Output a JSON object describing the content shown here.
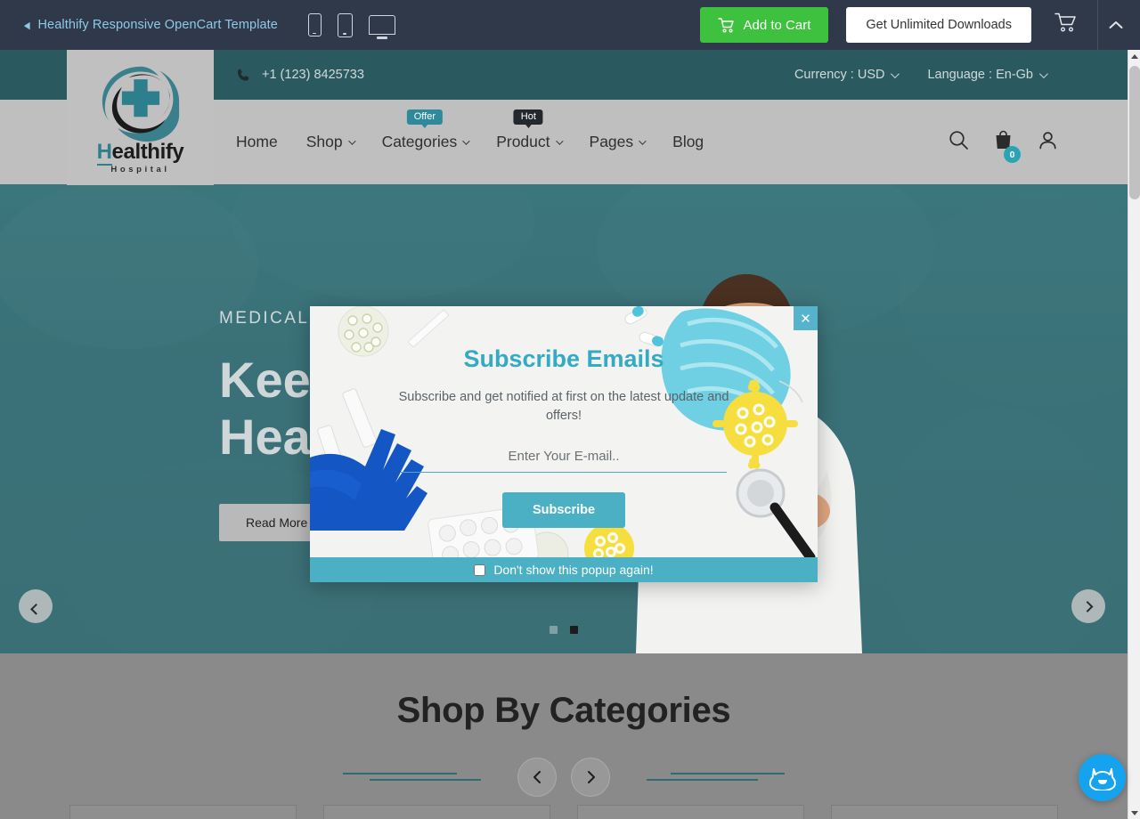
{
  "preview_bar": {
    "back_icon": "chevron-left-icon",
    "title": "Healthify Responsive OpenCart Template",
    "devices": [
      "phone-icon",
      "tablet-icon",
      "desktop-icon"
    ],
    "add_to_cart_label": "Add to Cart",
    "unlimited_label": "Get Unlimited Downloads",
    "cart_icon": "cart-icon",
    "collapse_icon": "chevron-up-icon",
    "bg_color": "#2f3949",
    "add_to_cart_color": "#3ec13e"
  },
  "topbar": {
    "phone_icon": "phone-icon",
    "phone": "+1 (123) 8425733",
    "currency_label": "Currency : USD",
    "language_label": "Language : En-Gb",
    "bg_color": "#2a5a60"
  },
  "logo": {
    "name": "Healthify",
    "name_first": "H",
    "name_rest": "ealthify",
    "tagline": "Hospital",
    "mark_icon": "medical-cross-swirl-logo"
  },
  "nav": {
    "items": [
      {
        "label": "Home",
        "has_dropdown": false,
        "badge": null
      },
      {
        "label": "Shop",
        "has_dropdown": true,
        "badge": null
      },
      {
        "label": "Categories",
        "has_dropdown": true,
        "badge": "Offer",
        "badge_type": "offer"
      },
      {
        "label": "Product",
        "has_dropdown": true,
        "badge": "Hot",
        "badge_type": "hot"
      },
      {
        "label": "Pages",
        "has_dropdown": true,
        "badge": null
      },
      {
        "label": "Blog",
        "has_dropdown": false,
        "badge": null
      }
    ],
    "icons": {
      "search": "search-icon",
      "bag": "shopping-bag-icon",
      "account": "user-account-icon"
    },
    "cart_count": "0",
    "bg_color": "#bfbfbf"
  },
  "hero": {
    "kicker": "MEDICAL C",
    "title_line1": "Keep",
    "title_line2": "Healt",
    "read_more": "Read More",
    "prev_icon": "chevron-left-icon",
    "next_icon": "chevron-right-icon",
    "slides": 2,
    "active_slide": 2,
    "bg_color": "#3b7077"
  },
  "categories_section": {
    "heading": "Shop By Categories",
    "prev_icon": "chevron-left-icon",
    "next_icon": "chevron-right-icon",
    "deco_color": "#2f6b73",
    "bg_color": "#8a8a8a"
  },
  "popup": {
    "title": "Subscribe Emails",
    "description": "Subscribe and get notified at first on the latest update and offers!",
    "email_placeholder": "Enter Your E-mail..",
    "email_value": "",
    "subscribe_label": "Subscribe",
    "dont_show_label": "Don't show this popup again!",
    "dont_show_checked": false,
    "close_icon": "close-x-icon",
    "accent_color": "#4cb0c4",
    "title_color": "#35aac4"
  },
  "chat_widget": {
    "icon": "chat-monster-icon",
    "color": "#15a3f0"
  },
  "scrollbar": {
    "up_icon": "scroll-up-arrow",
    "down_icon": "scroll-down-arrow"
  }
}
